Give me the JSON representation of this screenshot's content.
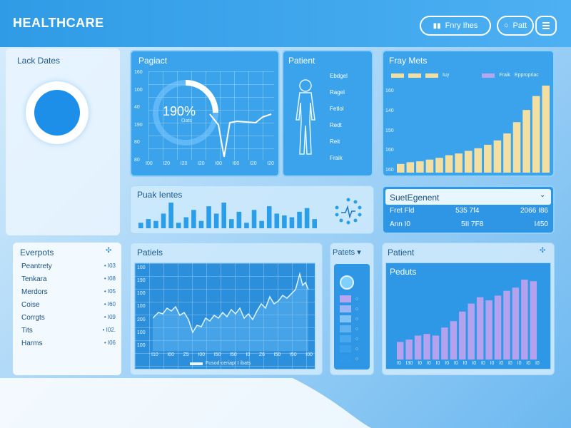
{
  "header": {
    "brand": "HEALTHCARE",
    "btn1": "Fnry Ihes",
    "btn2": "Patt"
  },
  "left": {
    "title": "Lack Dates"
  },
  "panel_pagact": {
    "title": "Pagiact",
    "percent": "190%",
    "sub": "Oats",
    "yticks": [
      "160",
      "100",
      "40",
      "190",
      "80",
      "80"
    ],
    "xticks": [
      "I00",
      "I20",
      "I20",
      "I20",
      "I00",
      "I00",
      "I20",
      "I20"
    ]
  },
  "panel_patient": {
    "title": "Patient",
    "labels": [
      "Ebdgel",
      "Ragel",
      "Fetlol",
      "Redt",
      "Reit",
      "Fraik"
    ]
  },
  "panel_fray": {
    "title": "Fray Mets",
    "legend": [
      "Iuy",
      "Fraik",
      "Eppropriac"
    ],
    "yticks": [
      "160",
      "140",
      "150",
      "160",
      "160"
    ],
    "chart_data": {
      "type": "bar",
      "values": [
        10,
        12,
        13,
        15,
        17,
        20,
        22,
        25,
        28,
        32,
        37,
        45,
        58,
        72,
        88,
        100
      ]
    }
  },
  "panel_peak": {
    "title": "Puak Ientes",
    "bars": [
      3,
      5,
      4,
      8,
      14,
      3,
      6,
      10,
      4,
      12,
      8,
      14,
      5,
      9,
      3,
      10,
      4,
      12,
      8,
      7,
      6,
      9,
      11,
      5
    ]
  },
  "panel_sect": {
    "title": "SuetEgenent",
    "rows": [
      {
        "a": "Fret Fld",
        "b": "535 7f4",
        "c": "2066 I86"
      },
      {
        "a": "Ann I0",
        "b": "5II 7F8",
        "c": "I450"
      }
    ]
  },
  "panel_everpots": {
    "title": "Everpots",
    "items": [
      {
        "label": "Peantrety",
        "val": "• I03"
      },
      {
        "label": "Tenkara",
        "val": "• I08"
      },
      {
        "label": "Merdors",
        "val": "• I05"
      },
      {
        "label": "Coise",
        "val": "• I60"
      },
      {
        "label": "Corrgts",
        "val": "• I09"
      },
      {
        "label": "Tits",
        "val": "• I02."
      },
      {
        "label": "Harms",
        "val": "• I06"
      }
    ]
  },
  "panel_patiels": {
    "title": "Patiels",
    "yticks": [
      "100",
      "190",
      "100",
      "100",
      "200",
      "100",
      "100"
    ],
    "xticks": [
      "I10",
      "I00",
      "Z5",
      "I00",
      "I50",
      "I50",
      "I0",
      "Z6",
      "I50",
      "I50",
      "I00"
    ],
    "legend": "Fusod-ceriapt I ibats"
  },
  "panel_patets": {
    "title": "Patets ▾"
  },
  "panel_patient2": {
    "title": "Patient",
    "subtitle": "Peduts",
    "chart_data": {
      "type": "bar",
      "values": [
        22,
        25,
        30,
        32,
        30,
        40,
        48,
        60,
        70,
        78,
        74,
        80,
        86,
        90,
        100,
        98
      ]
    },
    "xticks": [
      "I0",
      "I30",
      "I0",
      "I0",
      "I0",
      "I0",
      "I0",
      "I0",
      "I0",
      "I0",
      "I0",
      "I0",
      "I0",
      "I0",
      "I0",
      "I0"
    ]
  }
}
